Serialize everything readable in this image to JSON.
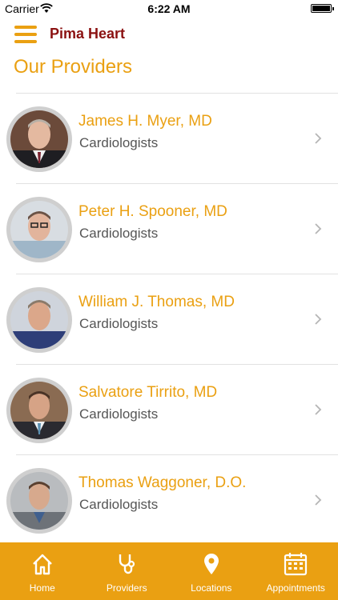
{
  "status": {
    "carrier": "Carrier",
    "time": "6:22 AM"
  },
  "header": {
    "title": "Pima Heart"
  },
  "page": {
    "title": "Our Providers"
  },
  "providers": [
    {
      "name": "James H. Myer, MD",
      "specialty": "Cardiologists"
    },
    {
      "name": "Peter H. Spooner, MD",
      "specialty": "Cardiologists"
    },
    {
      "name": "William J. Thomas, MD",
      "specialty": "Cardiologists"
    },
    {
      "name": "Salvatore Tirrito, MD",
      "specialty": "Cardiologists"
    },
    {
      "name": "Thomas Waggoner, D.O.",
      "specialty": "Cardiologists"
    }
  ],
  "tabs": [
    {
      "label": "Home",
      "icon": "home-icon"
    },
    {
      "label": "Providers",
      "icon": "stethoscope-icon"
    },
    {
      "label": "Locations",
      "icon": "map-pin-icon"
    },
    {
      "label": "Appointments",
      "icon": "calendar-icon"
    }
  ],
  "colors": {
    "accent": "#eaa012",
    "brand": "#8b1111",
    "text_secondary": "#555555"
  }
}
